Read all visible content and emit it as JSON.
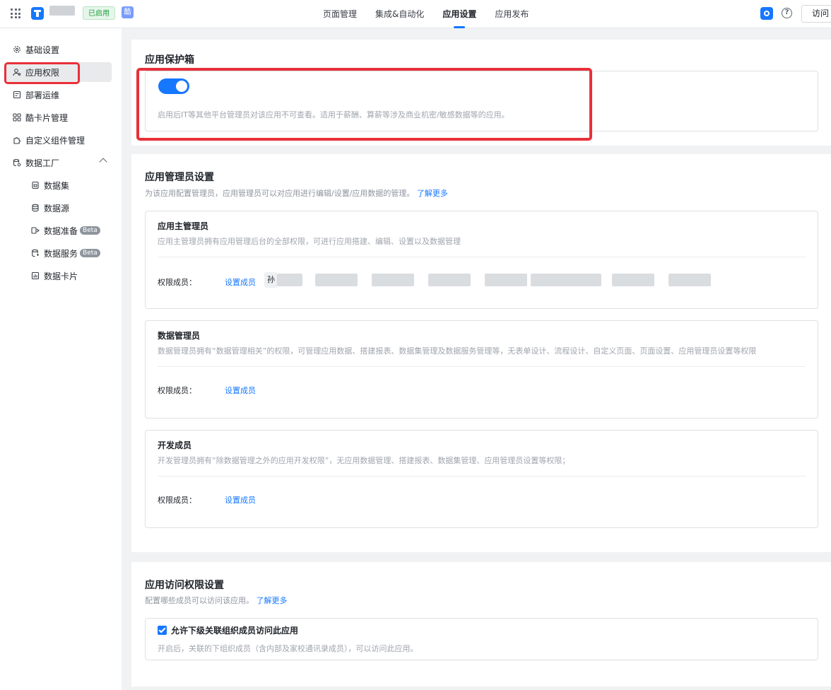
{
  "topbar": {
    "status_badge": "已启用",
    "ku_badge": "酷",
    "tabs": [
      {
        "label": "页面管理",
        "active": false
      },
      {
        "label": "集成&自动化",
        "active": false
      },
      {
        "label": "应用设置",
        "active": true
      },
      {
        "label": "应用发布",
        "active": false
      }
    ],
    "visit_label": "访问",
    "help_glyph": "?"
  },
  "sidebar": {
    "items": [
      {
        "label": "基础设置",
        "icon": "gear-icon"
      },
      {
        "label": "应用权限",
        "icon": "users-icon",
        "active": true
      },
      {
        "label": "部署运维",
        "icon": "deploy-icon"
      },
      {
        "label": "酷卡片管理",
        "icon": "grid-icon"
      },
      {
        "label": "自定义组件管理",
        "icon": "puzzle-icon"
      },
      {
        "label": "数据工厂",
        "icon": "data-factory-icon",
        "expanded": true
      }
    ],
    "sub_items": [
      {
        "label": "数据集",
        "icon": "dataset-icon"
      },
      {
        "label": "数据源",
        "icon": "database-icon"
      },
      {
        "label": "数据准备",
        "icon": "data-prep-icon",
        "badge": "Beta"
      },
      {
        "label": "数据服务",
        "icon": "data-service-icon",
        "badge": "Beta"
      },
      {
        "label": "数据卡片",
        "icon": "data-card-icon"
      }
    ]
  },
  "protect_box": {
    "title": "应用保护箱",
    "toggle_on": true,
    "desc": "启用后IT等其他平台管理员对该应用不可查看。适用于薪酬、算薪等涉及商业机密/敏感数据等的应用。"
  },
  "admin_settings": {
    "title": "应用管理员设置",
    "desc": "为该应用配置管理员，应用管理员可以对应用进行编辑/设置/应用数据的管理。",
    "learn_more": "了解更多",
    "cards": [
      {
        "title": "应用主管理员",
        "desc": "应用主管理员拥有应用管理后台的全部权限，可进行应用搭建、编辑、设置以及数据管理",
        "member_label": "权限成员：",
        "set_members": "设置成员",
        "member_chip": "孙"
      },
      {
        "title": "数据管理员",
        "desc": "数据管理员拥有“数据管理相关”的权限，可管理应用数据、搭建报表、数据集管理及数据服务管理等，无表单设计、流程设计、自定义页面、页面设置、应用管理员设置等权限",
        "member_label": "权限成员：",
        "set_members": "设置成员"
      },
      {
        "title": "开发成员",
        "desc": "开发管理员拥有“除数据管理之外的应用开发权限”，无应用数据管理、搭建报表、数据集管理、应用管理员设置等权限；",
        "member_label": "权限成员：",
        "set_members": "设置成员"
      }
    ]
  },
  "access_settings": {
    "title": "应用访问权限设置",
    "desc": "配置哪些成员可以访问该应用。",
    "learn_more": "了解更多",
    "checkbox_checked": true,
    "checkbox_label": "允许下级关联组织成员访问此应用",
    "checkbox_desc": "开启后，关联的下组织成员（含内部及家校通讯录成员），可以访问此应用。"
  },
  "colors": {
    "accent": "#1677ff",
    "highlight": "#e8303a",
    "status_green": "#1d9f3e"
  }
}
